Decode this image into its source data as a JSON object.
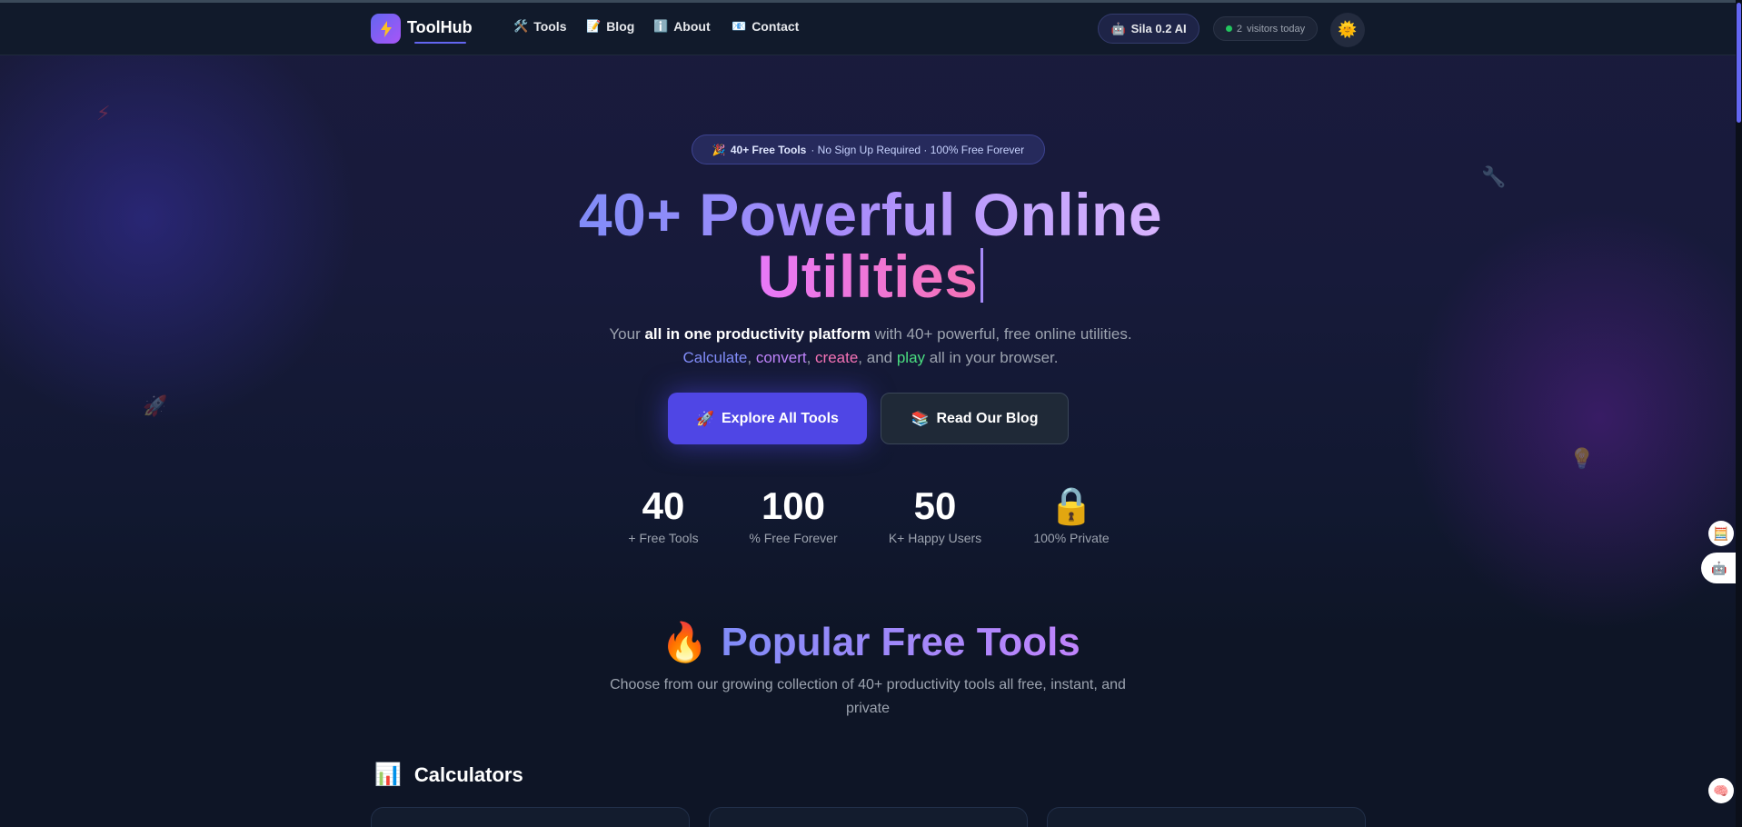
{
  "nav": {
    "logo_text": "ToolHub",
    "links": [
      {
        "icon": "🛠️",
        "label": "Tools"
      },
      {
        "icon": "📝",
        "label": "Blog"
      },
      {
        "icon": "ℹ️",
        "label": "About"
      },
      {
        "icon": "📧",
        "label": "Contact"
      }
    ],
    "ai_pill": {
      "icon": "🤖",
      "label": "Sila 0.2 AI"
    },
    "visitors": {
      "count": "2",
      "label": "visitors today"
    },
    "theme_icon": "🌞"
  },
  "hero": {
    "badge_icon": "🎉",
    "badge_bold": "40+ Free Tools",
    "badge_rest": "· No Sign Up Required · 100% Free Forever",
    "title_line1": "40+ Powerful Online",
    "title_line2": "Utilities",
    "sub_prefix": "Your ",
    "sub_bold": "all in one productivity platform",
    "sub_suffix": " with 40+ powerful, free online utilities.",
    "sub_w1": "Calculate",
    "sub_sep1": ", ",
    "sub_w2": "convert",
    "sub_sep2": ", ",
    "sub_w3": "create",
    "sub_sep3": ", and ",
    "sub_w4": "play",
    "sub_end": " all in your browser.",
    "primary_button": {
      "icon": "🚀",
      "label": "Explore All Tools"
    },
    "secondary_button": {
      "icon": "📚",
      "label": "Read Our Blog"
    }
  },
  "stats": [
    {
      "value": "40",
      "label": "+ Free Tools"
    },
    {
      "value": "100",
      "label": "% Free Forever"
    },
    {
      "value": "50",
      "label": "K+ Happy Users"
    },
    {
      "icon": "🔒",
      "label": "100% Private"
    }
  ],
  "popular": {
    "icon": "🔥",
    "title": "Popular Free Tools",
    "subtitle": "Choose from our growing collection of 40+ productivity tools all free, instant, and private"
  },
  "category": {
    "icon": "📊",
    "title": "Calculators"
  },
  "decor_icons": [
    "⚡",
    "🔧",
    "🚀",
    "💡"
  ],
  "side_widgets": [
    "🧮",
    "🤖",
    "🧠"
  ],
  "colors": {
    "accent": "#4f46e5",
    "background": "#0e1424",
    "nav": "#111a2b"
  }
}
